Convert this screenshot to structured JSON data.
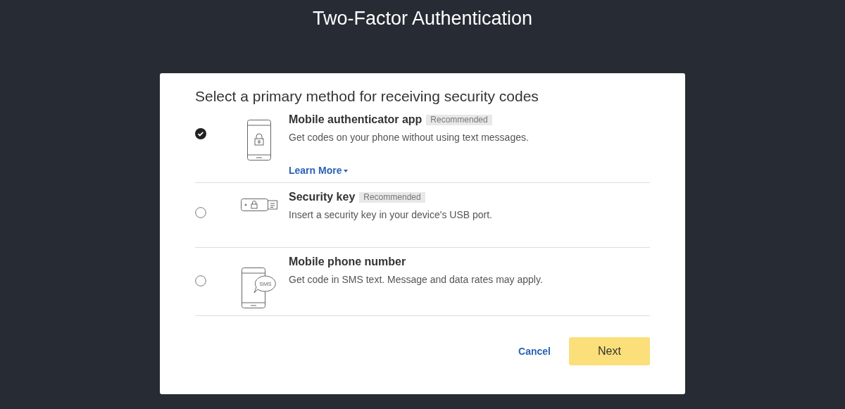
{
  "title": "Two-Factor Authentication",
  "heading": "Select a primary method for receiving security codes",
  "options": [
    {
      "kind": "app",
      "name": "Mobile authenticator app",
      "badge": "Recommended",
      "description": "Get codes on your phone without using text messages.",
      "link": "Learn More",
      "selected": true
    },
    {
      "kind": "key",
      "name": "Security key",
      "badge": "Recommended",
      "description": "Insert a security key in your device's USB port.",
      "selected": false
    },
    {
      "kind": "phone",
      "name": "Mobile phone number",
      "description": "Get code in SMS text. Message and data rates may apply.",
      "icon_text": "SMS",
      "selected": false
    }
  ],
  "buttons": {
    "cancel": "Cancel",
    "next": "Next"
  }
}
